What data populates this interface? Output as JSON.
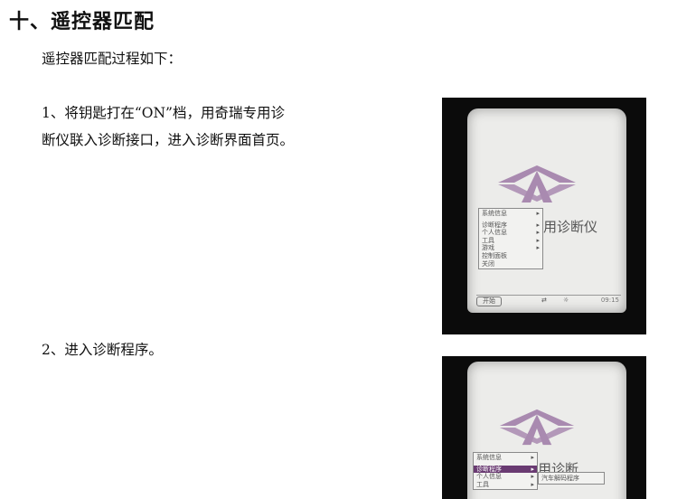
{
  "section_heading": "十、遥控器匹配",
  "intro": "遥控器匹配过程如下：",
  "step1_lines": [
    "1、将钥匙打在“ON”档，用奇瑞专用诊",
    "断仪联入诊断接口，进入诊断界面首页。"
  ],
  "step2": "2、进入诊断程序。",
  "screen1": {
    "menu": [
      {
        "label": "系统信息",
        "arrow": "▸"
      },
      {
        "label": "诊断程序",
        "arrow": "▸"
      },
      {
        "label": "个人信息",
        "arrow": "▸"
      },
      {
        "label": "工具",
        "arrow": "▸"
      },
      {
        "label": "游戏",
        "arrow": "▸"
      },
      {
        "label": "控制面板",
        "arrow": ""
      },
      {
        "label": "关闭",
        "arrow": ""
      }
    ],
    "title_fragment": "用诊断仪",
    "start_label": "开始",
    "clock": "09:15"
  },
  "screen2": {
    "menu": [
      {
        "label": "系统信息",
        "arrow": "▸"
      },
      {
        "label": "诊断程序",
        "arrow": "▸"
      },
      {
        "label": "个人信息",
        "arrow": "▸"
      },
      {
        "label": "工具",
        "arrow": "▸"
      }
    ],
    "title_fragment": "用诊断",
    "submenu_item": "汽车解码程序"
  },
  "colors": {
    "logo": "#a98ab0",
    "highlight": "#6a3b72",
    "screen": "#ececea"
  }
}
